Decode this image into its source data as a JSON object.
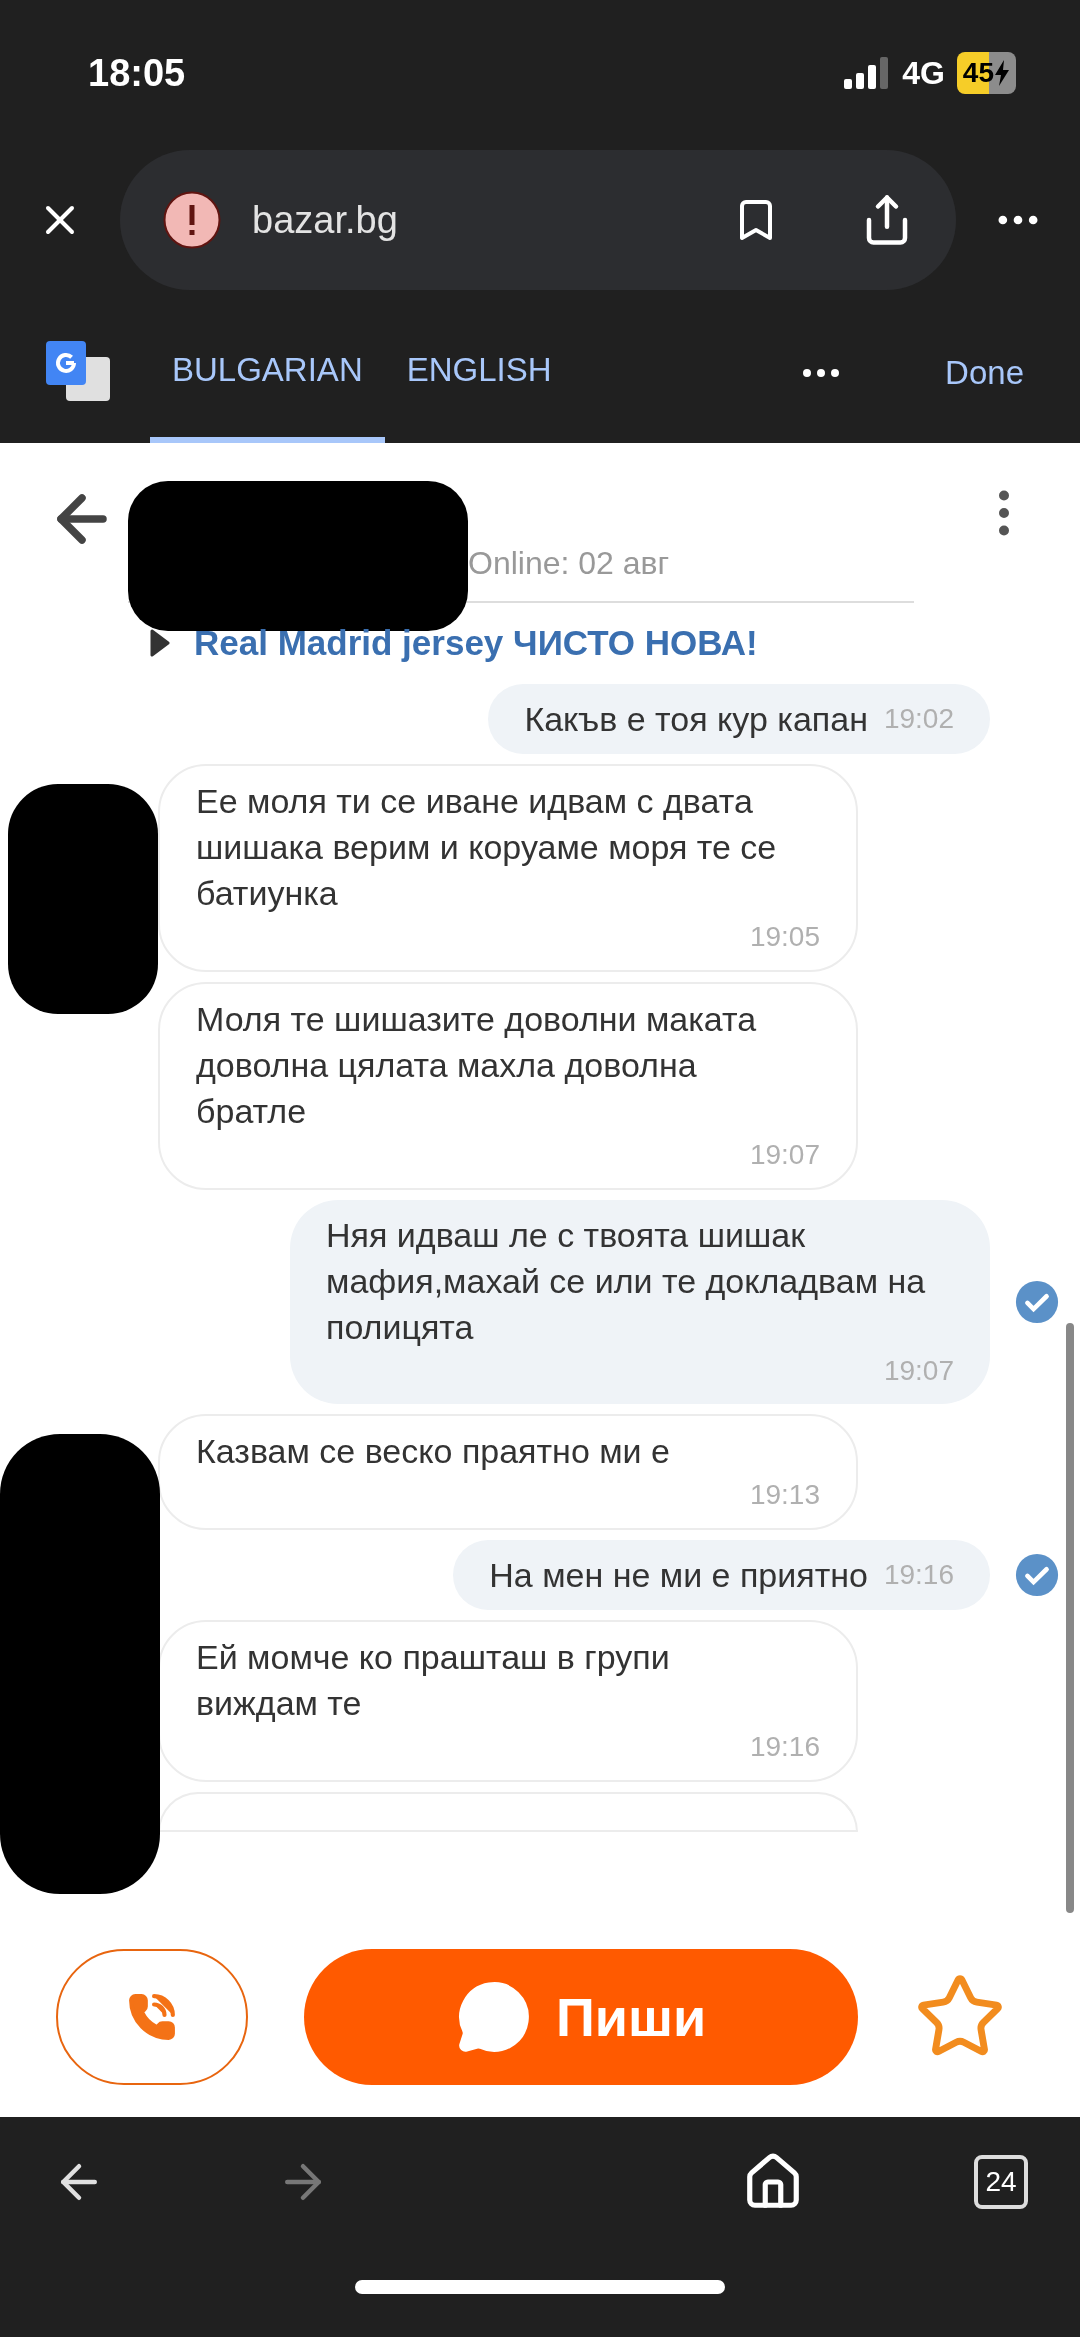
{
  "status_bar": {
    "time": "18:05",
    "network": "4G",
    "battery": "45"
  },
  "browser": {
    "url": "bazar.bg"
  },
  "translate_bar": {
    "tabs": [
      {
        "label": "BULGARIAN",
        "selected": true
      },
      {
        "label": "ENGLISH",
        "selected": false
      }
    ],
    "done": "Done"
  },
  "chat": {
    "last_seen": "Online: 02 авг",
    "listing": "Real Madrid jersey ЧИСТО НОВА!",
    "messages": [
      {
        "kind": "sent",
        "text": "Какъв е тоя кур капан",
        "time": "19:02",
        "read": false
      },
      {
        "kind": "received",
        "text": "Ее моля ти се иване идвам с двата шишака верим и коруаме моря те се батиунка",
        "time": "19:05"
      },
      {
        "kind": "received",
        "text": "Моля те шишазите доволни маката доволна цялата махла доволна братле",
        "time": "19:07"
      },
      {
        "kind": "sent",
        "text": "Няя идваш ле с твоята шишак мафия,махай се или те докладвам на полицята",
        "time": "19:07",
        "read": true
      },
      {
        "kind": "received",
        "text": "Казвам се веско праятно ми е",
        "time": "19:13"
      },
      {
        "kind": "sent",
        "text": "На мен не ми е приятно",
        "time": "19:16",
        "read": true
      },
      {
        "kind": "received",
        "text": "Ей момче ко прашташ в групи виждам те",
        "time": "19:16"
      }
    ]
  },
  "actions": {
    "write": "Пиши",
    "favorite": false
  },
  "bottom_bar": {
    "tabs_count": "24"
  }
}
